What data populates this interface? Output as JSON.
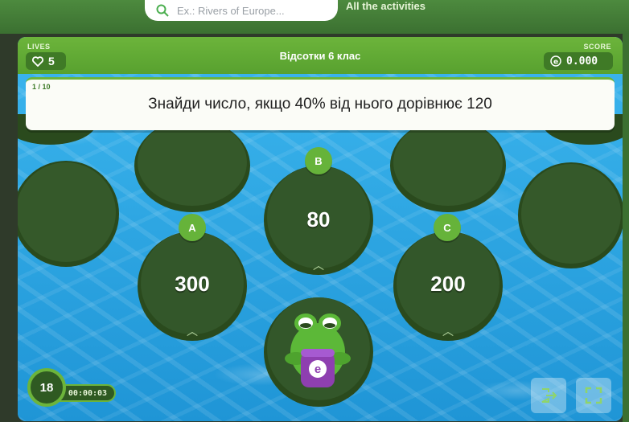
{
  "site": {
    "search_placeholder": "Ex.: Rivers of Europe...",
    "all_activities": "All the activities"
  },
  "game": {
    "lives_label": "LIVES",
    "lives": "5",
    "title": "Відсотки 6 клас",
    "score_label": "SCORE",
    "score": "0.000",
    "question_counter": "1 / 10",
    "question": "Знайди число, якщо 40% від нього дорівнює 120",
    "answers": [
      {
        "letter": "A",
        "value": "300"
      },
      {
        "letter": "B",
        "value": "80"
      },
      {
        "letter": "C",
        "value": "200"
      }
    ],
    "timer_seconds": "18",
    "elapsed": "00:00:03",
    "frog_badge": "e"
  },
  "icons": {
    "lives": "heart-icon",
    "score": "coin-icon",
    "exit": "exit-icon",
    "fullscreen": "fullscreen-icon"
  },
  "colors": {
    "accent_green": "#6cb43b",
    "pad_green": "#2e4a1f",
    "water_blue": "#2da4e0"
  }
}
